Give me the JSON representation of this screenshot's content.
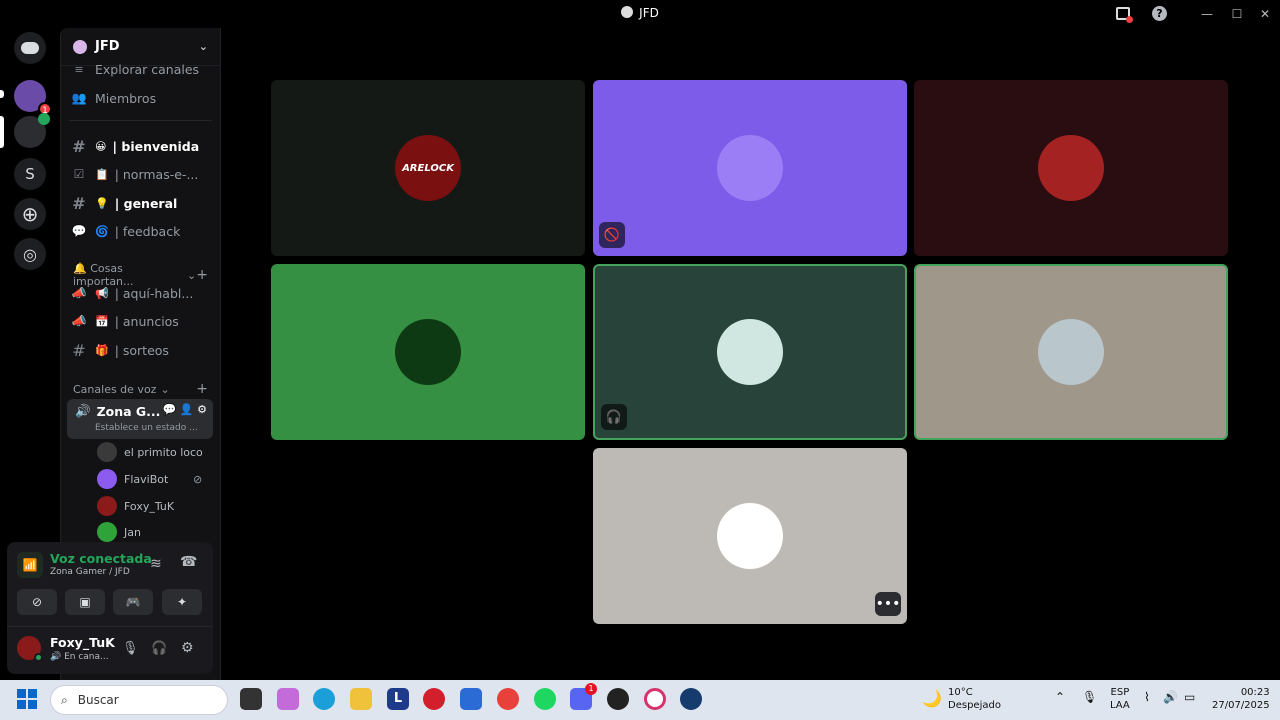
{
  "window": {
    "title": "JFD"
  },
  "guilds": {
    "badge_count": "1",
    "letter_server": "S"
  },
  "server": {
    "name": "JFD"
  },
  "nav": {
    "explore": "Explorar canales",
    "members": "Miembros"
  },
  "channels": [
    {
      "emoji": "😀",
      "name": "| bienvenida",
      "bold": true
    },
    {
      "emoji": "📋",
      "name": "| normas-e-...",
      "bold": false
    },
    {
      "emoji": "💡",
      "name": "| general",
      "bold": true
    },
    {
      "emoji": "🌀",
      "name": "| feedback",
      "bold": false
    }
  ],
  "category1": {
    "label": "🔔 Cosas importan...",
    "plus": "+"
  },
  "channels2": [
    {
      "emoji": "📢",
      "name": "| aquí-habl..."
    },
    {
      "emoji": "📅",
      "name": "| anuncios"
    },
    {
      "emoji": "🎁",
      "name": "| sorteos"
    }
  ],
  "voice_category": {
    "label": "Canales de voz",
    "plus": "+"
  },
  "voice_channel": {
    "name": "Zona G...",
    "status": "Establece un estado ..."
  },
  "voice_members": [
    {
      "name": "el primito loco",
      "color": "#3a3a3a"
    },
    {
      "name": "FlaviBot",
      "color": "#8c5cf0"
    },
    {
      "name": "Foxy_TuK",
      "color": "#8b1a1a"
    },
    {
      "name": "Jan",
      "color": "#2fa23a"
    }
  ],
  "voice_panel": {
    "status": "Voz conectada",
    "location": "Zona Gamer / JFD"
  },
  "user": {
    "name": "Foxy_TuK",
    "status": "En cana..."
  },
  "tiles": [
    {
      "bg": "#151915",
      "avatar": "#7a1010",
      "label": "ARELOCK",
      "speaking": false,
      "icon": ""
    },
    {
      "bg": "#7c5ce8",
      "avatar": "#9b7df5",
      "label": "",
      "speaking": false,
      "icon": "🚫"
    },
    {
      "bg": "#2a0d10",
      "avatar": "#a42222",
      "label": "",
      "speaking": false,
      "icon": ""
    },
    {
      "bg": "#369043",
      "avatar": "#0d3a12",
      "label": "",
      "speaking": false,
      "icon": ""
    },
    {
      "bg": "#284339",
      "avatar": "#cfe7e0",
      "label": "",
      "speaking": true,
      "icon": "🎧"
    },
    {
      "bg": "#9e978a",
      "avatar": "#b9c6cc",
      "label": "",
      "speaking": true,
      "icon": ""
    },
    {
      "bg": "#bdbab5",
      "avatar": "#ffffff",
      "label": "",
      "speaking": false,
      "icon": ""
    }
  ],
  "tile_more": "•••",
  "taskbar": {
    "search": "Buscar",
    "weather_temp": "10°C",
    "weather_desc": "Despejado",
    "lang1": "ESP",
    "lang2": "LAA",
    "time": "00:23",
    "date": "27/07/2025",
    "discord_badge": "1"
  }
}
